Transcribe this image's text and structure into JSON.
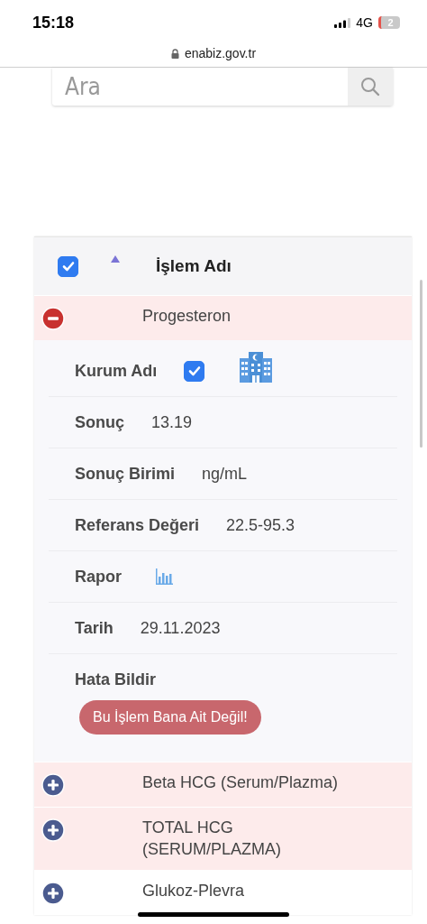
{
  "status_bar": {
    "time": "15:18",
    "network": "4G",
    "battery": "2"
  },
  "address_bar": {
    "url": "enabiz.gov.tr"
  },
  "search": {
    "placeholder": "Ara"
  },
  "table": {
    "header": {
      "checked": true,
      "sorted_ascending": true,
      "title": "İşlem Adı"
    },
    "rows": [
      {
        "name": "Progesteron",
        "expanded": true,
        "highlighted": true,
        "details": [
          {
            "kind": "checkbox",
            "label": "Kurum Adı",
            "checked": true
          },
          {
            "kind": "text",
            "label": "Sonuç",
            "value": "13.19"
          },
          {
            "kind": "text",
            "label": "Sonuç Birimi",
            "value": "ng/mL"
          },
          {
            "kind": "text",
            "label": "Referans Değeri",
            "value": "22.5-95.3"
          },
          {
            "kind": "report",
            "label": "Rapor"
          },
          {
            "kind": "text",
            "label": "Tarih",
            "value": "29.11.2023"
          }
        ],
        "error_report": {
          "label": "Hata Bildir",
          "button": "Bu İşlem Bana Ait Değil!"
        }
      },
      {
        "name": "Beta HCG (Serum/Plazma)",
        "expanded": false,
        "highlighted": true
      },
      {
        "name": "TOTAL HCG (SERUM/PLAZMA)",
        "expanded": false,
        "highlighted": true
      },
      {
        "name": "Glukoz-Plevra",
        "expanded": false,
        "highlighted": false
      }
    ]
  }
}
